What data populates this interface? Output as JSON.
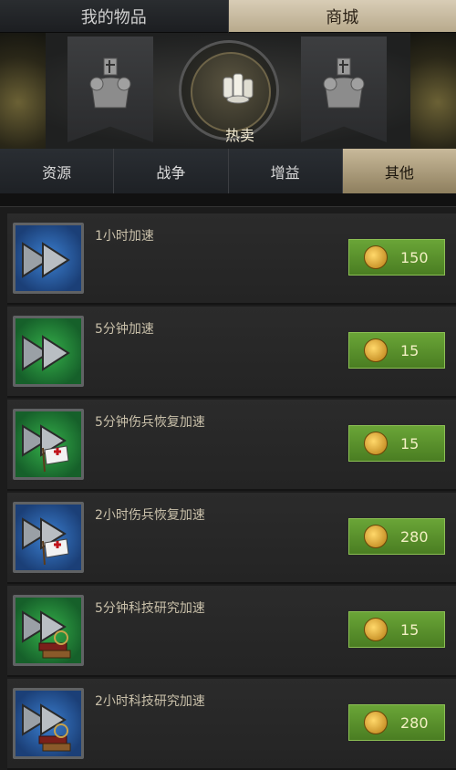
{
  "top_tabs": [
    {
      "label": "我的物品",
      "active": false
    },
    {
      "label": "商城",
      "active": true
    }
  ],
  "banner": {
    "hot_label": "热卖"
  },
  "sub_tabs": [
    {
      "label": "资源",
      "active": false
    },
    {
      "label": "战争",
      "active": false
    },
    {
      "label": "增益",
      "active": false
    },
    {
      "label": "其他",
      "active": true
    }
  ],
  "items": [
    {
      "name": "1小时加速",
      "price": "150",
      "icon_color": "blue",
      "icon": "speedup-arrow-icon"
    },
    {
      "name": "5分钟加速",
      "price": "15",
      "icon_color": "green",
      "icon": "speedup-arrow-icon"
    },
    {
      "name": "5分钟伤兵恢复加速",
      "price": "15",
      "icon_color": "green",
      "icon": "heal-speedup-icon"
    },
    {
      "name": "2小时伤兵恢复加速",
      "price": "280",
      "icon_color": "blue",
      "icon": "heal-speedup-icon"
    },
    {
      "name": "5分钟科技研究加速",
      "price": "15",
      "icon_color": "green",
      "icon": "research-speedup-icon"
    },
    {
      "name": "2小时科技研究加速",
      "price": "280",
      "icon_color": "blue",
      "icon": "research-speedup-icon"
    }
  ],
  "colors": {
    "accent_gold": "#c8b99a",
    "buy_green": "#5a9a2e",
    "price_text": "#f3f0c4"
  }
}
